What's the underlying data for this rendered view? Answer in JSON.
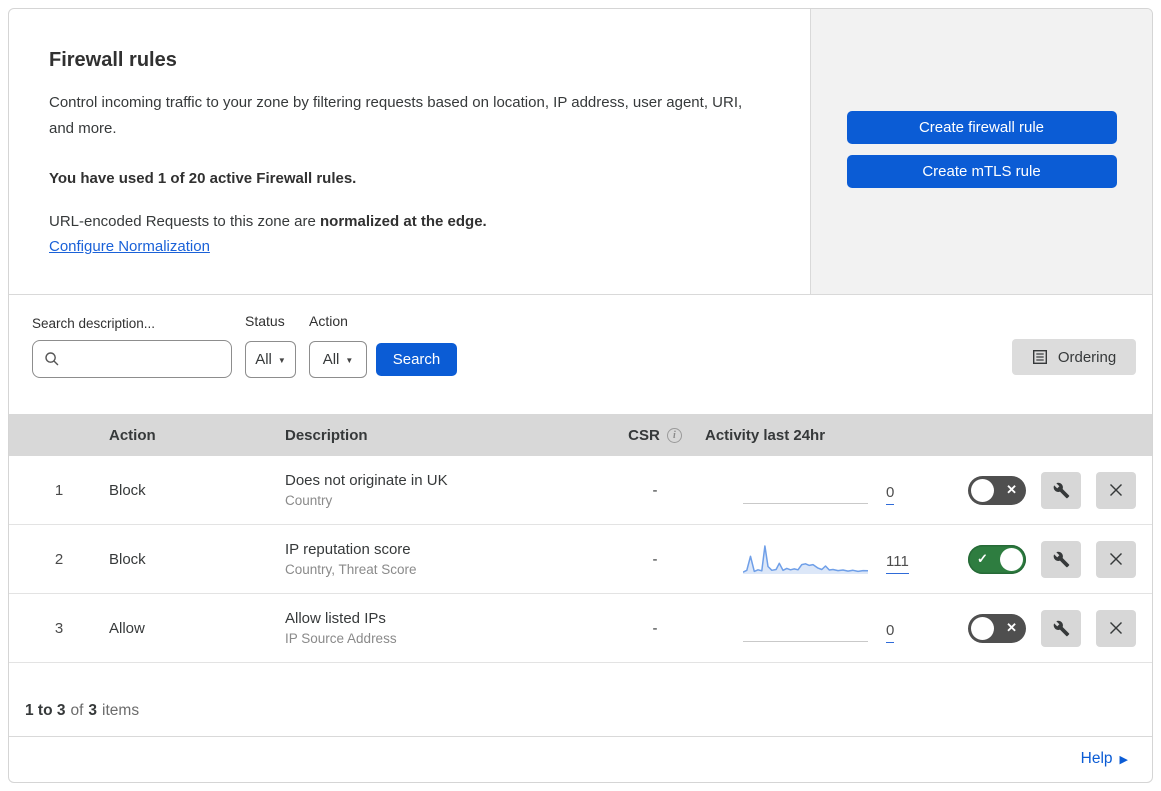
{
  "header": {
    "title": "Firewall rules",
    "description": "Control incoming traffic to your zone by filtering requests based on location, IP address, user agent, URI, and more.",
    "usage_line": "You have used 1 of 20 active Firewall rules.",
    "normalization_text": "URL-encoded Requests to this zone are ",
    "normalization_bold": "normalized at the edge.",
    "normalization_link": "Configure Normalization",
    "buttons": {
      "create_firewall": "Create firewall rule",
      "create_mtls": "Create mTLS rule"
    }
  },
  "filters": {
    "search_label": "Search description...",
    "search_placeholder": "",
    "search_value": "",
    "status_label": "Status",
    "status_value": "All",
    "action_label": "Action",
    "action_value": "All",
    "search_button": "Search",
    "ordering_button": "Ordering"
  },
  "table": {
    "columns": {
      "action": "Action",
      "description": "Description",
      "csr": "CSR",
      "activity": "Activity last 24hr"
    },
    "rules": [
      {
        "priority": "1",
        "action": "Block",
        "description": "Does not originate in UK",
        "criteria": "Country",
        "csr": "-",
        "activity_count": "0",
        "enabled": false,
        "sparkline": null
      },
      {
        "priority": "2",
        "action": "Block",
        "description": "IP reputation score",
        "criteria": "Country, Threat Score",
        "csr": "-",
        "activity_count": "111",
        "enabled": true,
        "sparkline": [
          [
            0.0,
            0.03
          ],
          [
            0.03,
            0.1
          ],
          [
            0.06,
            0.62
          ],
          [
            0.09,
            0.06
          ],
          [
            0.12,
            0.12
          ],
          [
            0.15,
            0.08
          ],
          [
            0.175,
            1.0
          ],
          [
            0.2,
            0.24
          ],
          [
            0.23,
            0.1
          ],
          [
            0.265,
            0.13
          ],
          [
            0.29,
            0.36
          ],
          [
            0.32,
            0.1
          ],
          [
            0.35,
            0.17
          ],
          [
            0.38,
            0.12
          ],
          [
            0.41,
            0.15
          ],
          [
            0.44,
            0.12
          ],
          [
            0.47,
            0.31
          ],
          [
            0.5,
            0.34
          ],
          [
            0.53,
            0.28
          ],
          [
            0.56,
            0.31
          ],
          [
            0.6,
            0.18
          ],
          [
            0.63,
            0.13
          ],
          [
            0.66,
            0.26
          ],
          [
            0.69,
            0.11
          ],
          [
            0.72,
            0.13
          ],
          [
            0.76,
            0.09
          ],
          [
            0.8,
            0.11
          ],
          [
            0.84,
            0.07
          ],
          [
            0.88,
            0.1
          ],
          [
            0.92,
            0.06
          ],
          [
            0.96,
            0.09
          ],
          [
            1.0,
            0.08
          ]
        ]
      },
      {
        "priority": "3",
        "action": "Allow",
        "description": "Allow listed IPs",
        "criteria": "IP Source Address",
        "csr": "-",
        "activity_count": "0",
        "enabled": false,
        "sparkline": null
      }
    ]
  },
  "footer": {
    "range": "1 to 3",
    "of": "of",
    "total": "3",
    "items": "items",
    "help": "Help"
  },
  "colors": {
    "accent_blue": "#0b5cd5",
    "link_blue": "#1a61d8",
    "toggle_on_green": "#2e7d40",
    "toggle_off_gray": "#4f4f4f",
    "sparkline_blue": "#6f9fe8",
    "table_header_gray": "#d8d8d8",
    "panel_gray": "#f2f2f2"
  }
}
